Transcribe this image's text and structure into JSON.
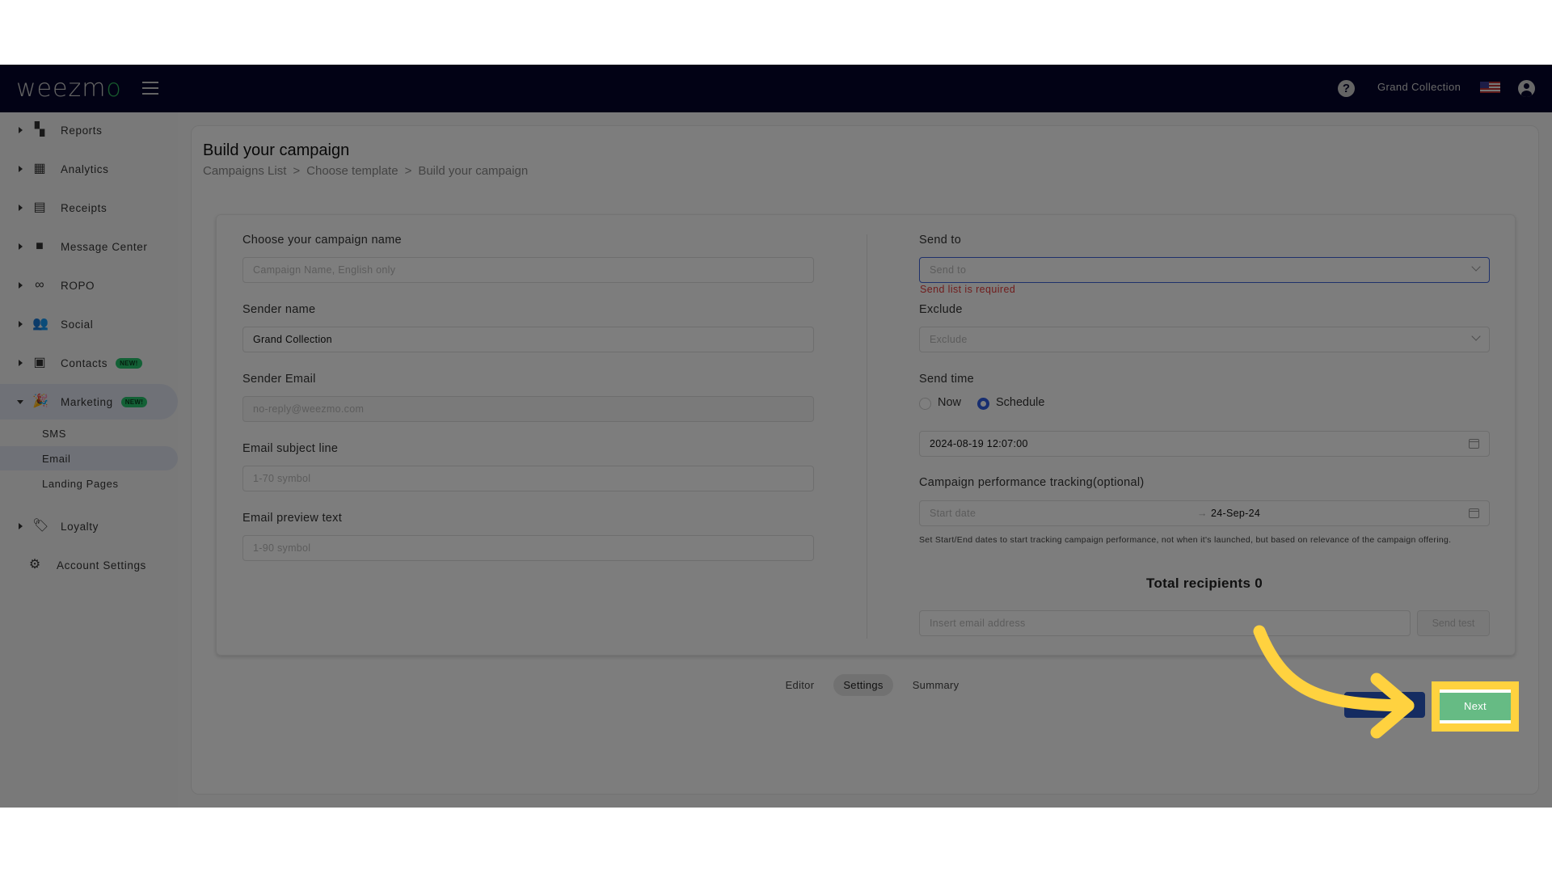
{
  "header": {
    "logo": "weezmo",
    "account_name": "Grand Collection",
    "icons": {
      "menu": "hamburger-icon",
      "help": "help-icon",
      "flag": "us-flag-icon",
      "user": "user-icon"
    }
  },
  "sidebar": {
    "items": [
      {
        "label": "Reports",
        "icon": "dashboard-icon"
      },
      {
        "label": "Analytics",
        "icon": "analytics-icon"
      },
      {
        "label": "Receipts",
        "icon": "receipt-icon"
      },
      {
        "label": "Message Center",
        "icon": "message-icon"
      },
      {
        "label": "ROPO",
        "icon": "infinity-icon"
      },
      {
        "label": "Social",
        "icon": "people-icon"
      },
      {
        "label": "Contacts",
        "icon": "contacts-icon",
        "badge": "NEW!"
      },
      {
        "label": "Marketing",
        "icon": "party-icon",
        "badge": "NEW!",
        "expanded": true
      },
      {
        "label": "Loyalty",
        "icon": "tag-heart-icon"
      },
      {
        "label": "Account Settings",
        "icon": "gear-icon"
      }
    ],
    "marketing_sub": [
      {
        "label": "SMS"
      },
      {
        "label": "Email",
        "active": true
      },
      {
        "label": "Landing Pages"
      }
    ]
  },
  "page": {
    "title": "Build your campaign",
    "breadcrumb": [
      "Campaigns List",
      ">",
      "Choose template",
      ">",
      "Build your campaign"
    ]
  },
  "form": {
    "left": {
      "campaign_name": {
        "label": "Choose your campaign name",
        "value": "",
        "placeholder": "Campaign Name, English only"
      },
      "sender_name": {
        "label": "Sender name",
        "value": "Grand Collection"
      },
      "sender_email": {
        "label": "Sender Email",
        "value": "",
        "placeholder": "no-reply@weezmo.com"
      },
      "subject": {
        "label": "Email subject line",
        "value": "",
        "placeholder": "1-70 symbol"
      },
      "preview": {
        "label": "Email preview text",
        "value": "",
        "placeholder": "1-90 symbol"
      }
    },
    "right": {
      "send_to": {
        "label": "Send to",
        "placeholder": "Send to",
        "error": "Send list is required"
      },
      "exclude": {
        "label": "Exclude",
        "placeholder": "Exclude"
      },
      "send_time": {
        "label": "Send time",
        "options": [
          "Now",
          "Schedule"
        ],
        "selected": "Schedule",
        "value": "2024-08-19 12:07:00"
      },
      "tracking": {
        "label": "Campaign performance tracking(optional)",
        "start_placeholder": "Start date",
        "end_value": "24-Sep-24",
        "arrow": "→",
        "hint": "Set Start/End dates to start tracking campaign performance, not when it's launched, but based on relevance of the campaign offering."
      },
      "total_recipients": "Total recipients 0",
      "test_email": {
        "placeholder": "Insert email address",
        "button": "Send test"
      }
    }
  },
  "steps": [
    {
      "label": "Editor"
    },
    {
      "label": "Settings",
      "active": true
    },
    {
      "label": "Summary"
    }
  ],
  "actions": {
    "next": "Next",
    "back": ""
  },
  "annotation": {
    "highlight_color": "#ffd23f",
    "target": "Next"
  }
}
